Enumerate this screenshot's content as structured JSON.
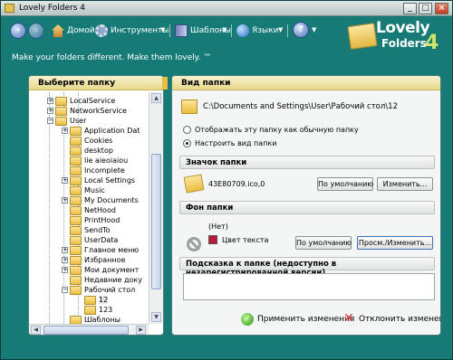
{
  "app": {
    "title": "Lovely Folders 4"
  },
  "toolbar": {
    "home": "Домой",
    "tools": "Инструменты",
    "templates": "Шаблоны",
    "languages": "Языки",
    "help_icon": "?"
  },
  "logo": {
    "line1": "Lovely",
    "line2": "Folders",
    "version": "4"
  },
  "tagline": "Make your folders different. Make them lovely. ™",
  "left_panel": {
    "header": "Выберите папку",
    "tree": [
      {
        "label": "LocalService",
        "depth": 1,
        "expander": "+"
      },
      {
        "label": "NetworkService",
        "depth": 1,
        "expander": "+"
      },
      {
        "label": "User",
        "depth": 1,
        "expander": "−"
      },
      {
        "label": "Application Dat",
        "depth": 2,
        "expander": "+"
      },
      {
        "label": "Cookies",
        "depth": 2,
        "expander": ""
      },
      {
        "label": "desktop",
        "depth": 2,
        "expander": ""
      },
      {
        "label": "lie aieoiaiou",
        "depth": 2,
        "expander": ""
      },
      {
        "label": "Incomplete",
        "depth": 2,
        "expander": ""
      },
      {
        "label": "Local Settings",
        "depth": 2,
        "expander": "+"
      },
      {
        "label": "Music",
        "depth": 2,
        "expander": ""
      },
      {
        "label": "My Documents",
        "depth": 2,
        "expander": "+"
      },
      {
        "label": "NetHood",
        "depth": 2,
        "expander": ""
      },
      {
        "label": "PrintHood",
        "depth": 2,
        "expander": ""
      },
      {
        "label": "SendTo",
        "depth": 2,
        "expander": ""
      },
      {
        "label": "UserData",
        "depth": 2,
        "expander": ""
      },
      {
        "label": "Главное меню",
        "depth": 2,
        "expander": "+"
      },
      {
        "label": "Избранное",
        "depth": 2,
        "expander": "+"
      },
      {
        "label": "Мои документ",
        "depth": 2,
        "expander": "+"
      },
      {
        "label": "Недавние доку",
        "depth": 2,
        "expander": ""
      },
      {
        "label": "Рабочий стол",
        "depth": 2,
        "expander": "−"
      },
      {
        "label": "12",
        "depth": 3,
        "expander": "",
        "selected": true
      },
      {
        "label": "123",
        "depth": 3,
        "expander": ""
      },
      {
        "label": "Шаблоны",
        "depth": 2,
        "expander": ""
      }
    ]
  },
  "right_panel": {
    "header": "Вид папки",
    "path": "C:\\Documents and Settings\\User\\Рабочий стол\\12",
    "option_normal": "Отображать эту папку как обычную папку",
    "option_custom": "Настроить вид папки",
    "icon_section": {
      "header": "Значок папки",
      "file": "43E80709.ico,0",
      "default_btn": "По умолчанию",
      "change_btn": "Изменить..."
    },
    "bg_section": {
      "header": "Фон папки",
      "none_label": "(Нет)",
      "text_color_label": "Цвет текста",
      "text_color": "#c0183a",
      "default_btn": "По умолчанию",
      "browse_btn": "Просм./Изменить..."
    },
    "tooltip_section": {
      "header": "Подсказка к папке (недоступно в незарегистрированной версии)",
      "value": ""
    },
    "apply": "Применить изменения",
    "discard": "Отклонить изменения"
  },
  "colors": {
    "window_bg": "#167b76",
    "panel_header": "#e8d98a",
    "accent": "#4a72b8"
  }
}
